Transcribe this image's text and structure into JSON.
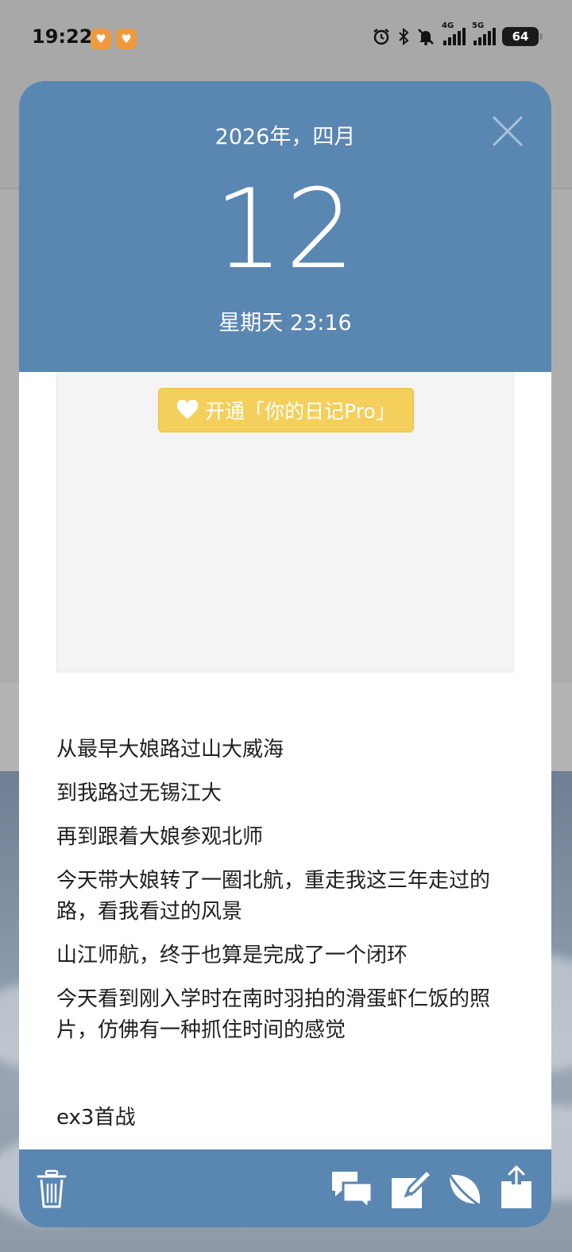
{
  "status_bar": {
    "time": "19:22",
    "app_badges": [
      "badge",
      "badge"
    ],
    "network_1": "4G",
    "network_2": "5G",
    "battery": "64"
  },
  "header": {
    "month_year": "2026年，四月",
    "day": "12",
    "weekday_time": "星期天 23:16",
    "close_icon": "close-icon"
  },
  "promo": {
    "label": "开通「你的日记Pro」",
    "icon": "heart-icon"
  },
  "entry": {
    "paragraphs": [
      "从最早大娘路过山大威海",
      "到我路过无锡江大",
      "再到跟着大娘参观北师",
      "今天带大娘转了一圈北航，重走我这三年走过的路，看我看过的风景",
      "山江师航，终于也算是完成了一个闭环",
      "今天看到刚入学时在南时羽拍的滑蛋虾仁饭的照片，仿佛有一种抓住时间的感觉",
      "",
      "ex3首战"
    ]
  },
  "toolbar": {
    "icons": [
      "trash-icon",
      "comments-icon",
      "edit-icon",
      "leaf-icon",
      "share-icon"
    ]
  },
  "colors": {
    "header": "#5a86b2",
    "promo": "#f5cf5c",
    "text": "#1f1f1f"
  }
}
